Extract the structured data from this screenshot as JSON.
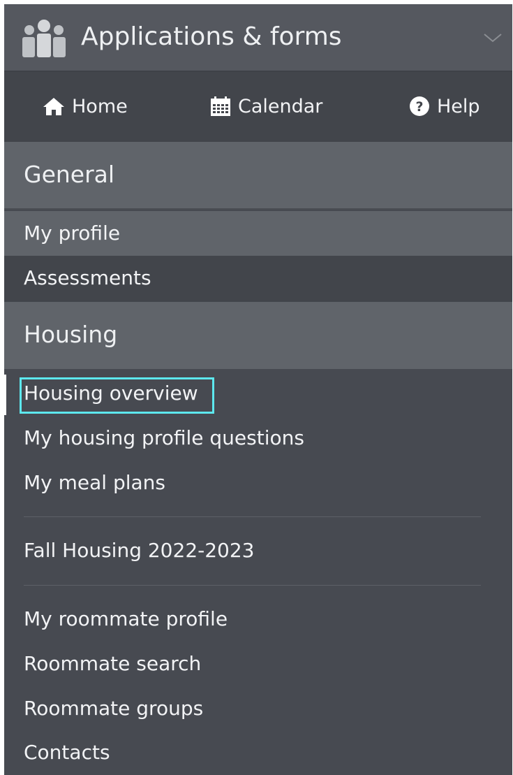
{
  "header": {
    "title": "Applications & forms",
    "icon": "people-group-icon",
    "toggle_icon": "chevron-down-icon"
  },
  "nav": {
    "home": {
      "label": "Home",
      "icon": "home-icon"
    },
    "calendar": {
      "label": "Calendar",
      "icon": "calendar-icon"
    },
    "help": {
      "label": "Help",
      "icon": "question-circle-icon"
    }
  },
  "sections": {
    "general": {
      "title": "General",
      "items": [
        {
          "label": "My profile"
        },
        {
          "label": "Assessments"
        }
      ]
    },
    "housing": {
      "title": "Housing",
      "items": [
        {
          "label": "Housing overview",
          "active": true
        },
        {
          "label": "My housing profile questions"
        },
        {
          "label": "My meal plans"
        },
        {
          "label": "Fall Housing 2022-2023"
        },
        {
          "label": "My roommate profile"
        },
        {
          "label": "Roommate search"
        },
        {
          "label": "Roommate groups"
        },
        {
          "label": "Contacts"
        }
      ]
    }
  },
  "colors": {
    "panel_background": "#474a51",
    "section_header": "#60646a",
    "active_highlight": "#5de8ee",
    "text": "#f2f3f5"
  }
}
